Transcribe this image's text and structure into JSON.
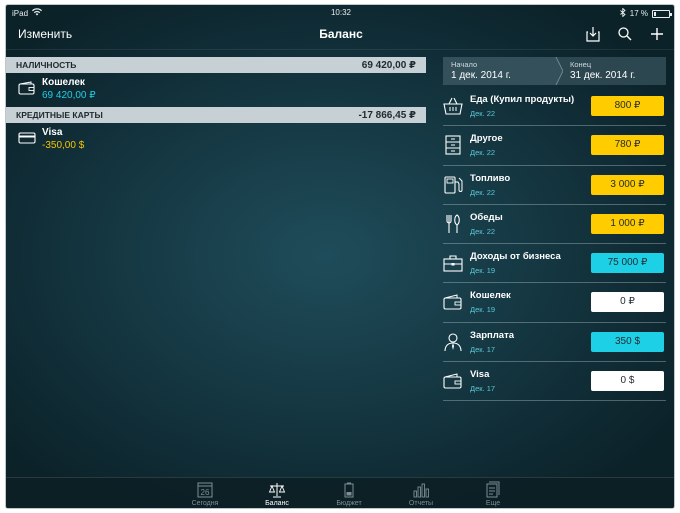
{
  "status": {
    "device": "iPad",
    "time": "10:32",
    "battery": "17 %",
    "battery_level": 0.17
  },
  "nav": {
    "edit_label": "Изменить",
    "title": "Баланс"
  },
  "sections": [
    {
      "header": "НАЛИЧНОСТЬ",
      "total": "69 420,00 ₽",
      "accounts": [
        {
          "name": "Кошелек",
          "balance": "69 420,00 ₽",
          "color": "#1ed0e6",
          "icon": "wallet-icon"
        }
      ]
    },
    {
      "header": "КРЕДИТНЫЕ КАРТЫ",
      "total": "-17 866,45 ₽",
      "accounts": [
        {
          "name": "Visa",
          "balance": "-350,00 $",
          "color": "#f5c400",
          "icon": "card-icon"
        }
      ]
    }
  ],
  "period": {
    "start_label": "Начало",
    "start_value": "1 дек. 2014 г.",
    "end_label": "Конец",
    "end_value": "31 дек. 2014 г."
  },
  "categories": [
    {
      "name": "Еда (Купил продукты)",
      "date": "Дек. 22",
      "amount": "800 ₽",
      "style": "yellow",
      "icon": "basket-icon"
    },
    {
      "name": "Другое",
      "date": "Дек. 22",
      "amount": "780 ₽",
      "style": "yellow",
      "icon": "cabinet-icon"
    },
    {
      "name": "Топливо",
      "date": "Дек. 22",
      "amount": "3 000 ₽",
      "style": "yellow",
      "icon": "fuel-icon"
    },
    {
      "name": "Обеды",
      "date": "Дек. 22",
      "amount": "1 000 ₽",
      "style": "yellow",
      "icon": "cutlery-icon"
    },
    {
      "name": "Доходы от бизнеса",
      "date": "Дек. 19",
      "amount": "75 000 ₽",
      "style": "cyan",
      "icon": "briefcase-icon"
    },
    {
      "name": "Кошелек",
      "date": "Дек. 19",
      "amount": "0 ₽",
      "style": "white",
      "icon": "wallet-icon"
    },
    {
      "name": "Зарплата",
      "date": "Дек. 17",
      "amount": "350 $",
      "style": "cyan",
      "icon": "person-icon"
    },
    {
      "name": "Visa",
      "date": "Дек. 17",
      "amount": "0 $",
      "style": "white",
      "icon": "wallet-icon"
    }
  ],
  "tabbar": {
    "calendar_day": "26",
    "items": [
      {
        "label": "Сегодня",
        "icon": "calendar-icon",
        "active": false
      },
      {
        "label": "Баланс",
        "icon": "scales-icon",
        "active": true
      },
      {
        "label": "Бюджет",
        "icon": "battery-icon",
        "active": false
      },
      {
        "label": "Отчеты",
        "icon": "bar-chart-icon",
        "active": false
      },
      {
        "label": "Еще",
        "icon": "documents-icon",
        "active": false
      }
    ]
  },
  "colors": {
    "accent_cyan": "#1ed0e6",
    "accent_yellow": "#ffcc00",
    "header_gray": "#c7d0d4"
  }
}
